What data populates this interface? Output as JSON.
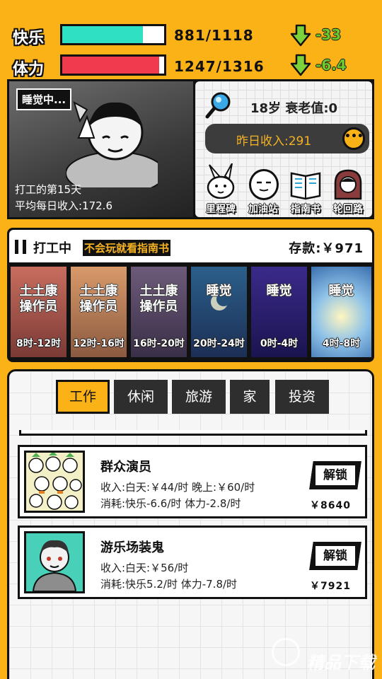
{
  "stats": {
    "happiness": {
      "label": "快乐",
      "value": "881/1118",
      "fill": 0.79,
      "delta": "-33",
      "color": "#2FE0C3"
    },
    "stamina": {
      "label": "体力",
      "value": "1247/1316",
      "fill": 0.95,
      "delta": "-6.4",
      "color": "#F23A4E"
    }
  },
  "status": {
    "sleep_tag": "睡觉中...",
    "day_text": "打工的第15天",
    "avg_income": "平均每日收入:172.6"
  },
  "profile": {
    "age_text": "18岁  衰老值:0",
    "yesterday_income": "昨日收入:291",
    "more_label": "•••"
  },
  "shortcuts": [
    {
      "label": "里程碑",
      "icon": "rabbit-icon"
    },
    {
      "label": "加油站",
      "icon": "face-icon"
    },
    {
      "label": "指南书",
      "icon": "book-icon"
    },
    {
      "label": "轮回路",
      "icon": "portal-icon"
    }
  ],
  "schedule": {
    "title": "打工中",
    "hint": "不会玩就看指南书",
    "savings": "存款:￥971",
    "slots": [
      {
        "name": "土土康操作员",
        "time": "8时-12时"
      },
      {
        "name": "土土康操作员",
        "time": "12时-16时"
      },
      {
        "name": "土土康操作员",
        "time": "16时-20时"
      },
      {
        "name": "睡觉",
        "time": "20时-24时"
      },
      {
        "name": "睡觉",
        "time": "0时-4时"
      },
      {
        "name": "睡觉",
        "time": "4时-8时"
      }
    ]
  },
  "tabs": [
    "工作",
    "休闲",
    "旅游",
    "家",
    "投资"
  ],
  "jobs": [
    {
      "name": "群众演员",
      "income": "收入:白天:￥44/时  晚上:￥60/时",
      "cost": "消耗:快乐-6.6/时 体力-2.8/时",
      "button": "解锁",
      "price": "￥8640"
    },
    {
      "name": "游乐场装鬼",
      "income": "收入:白天:￥56/时",
      "cost": "消耗:快乐5.2/时 体力-7.8/时",
      "button": "解锁",
      "price": "￥7921"
    }
  ],
  "watermark": "精品下载"
}
